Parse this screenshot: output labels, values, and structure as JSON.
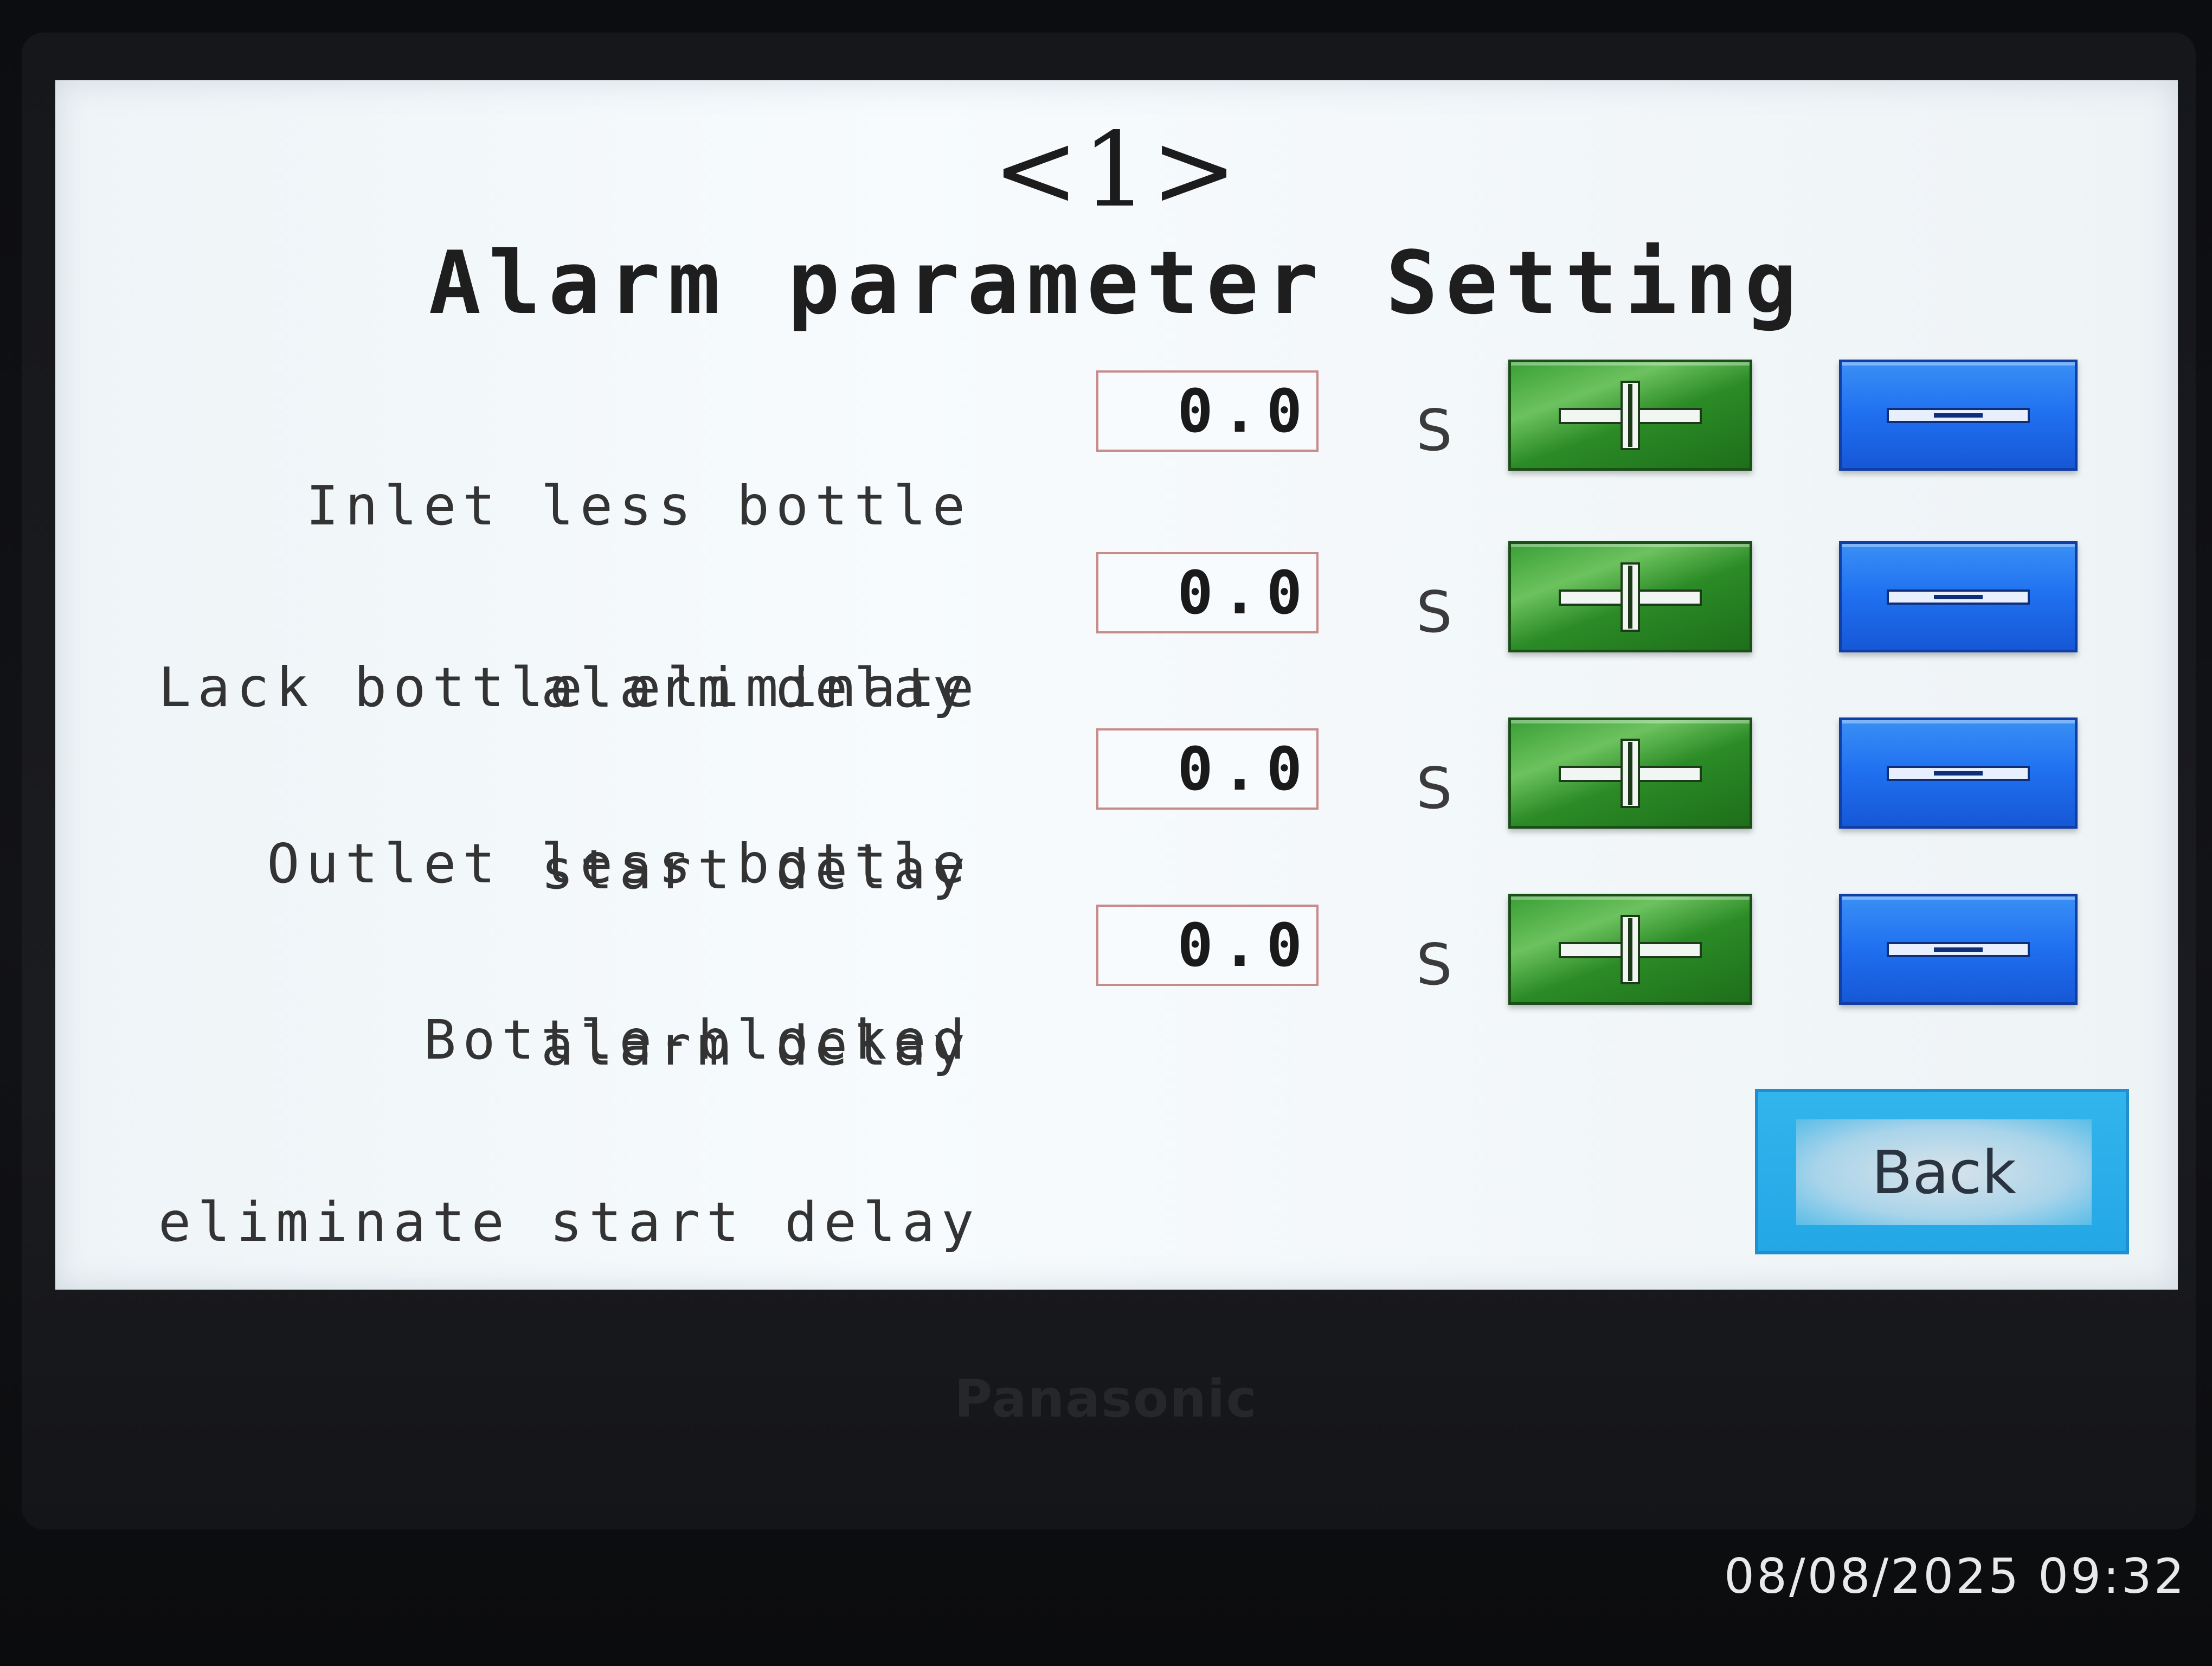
{
  "screen": {
    "page_number": "<1>",
    "title": "Alarm parameter Setting"
  },
  "parameters": [
    {
      "label_line1": "Inlet less bottle",
      "label_line2": "alarm delay",
      "value": "0.0",
      "unit": "S"
    },
    {
      "label_line1": "Lack bottle eliminate",
      "label_line2": "start delay",
      "value": "0.0",
      "unit": "S"
    },
    {
      "label_line1": "Outlet less bottle",
      "label_line2": "alarm delay",
      "value": "0.0",
      "unit": "S"
    },
    {
      "label_line1": "Bottle-blocked",
      "label_line2": "eliminate start delay",
      "value": "0.0",
      "unit": "S"
    }
  ],
  "buttons": {
    "increase_icon": "plus-icon",
    "decrease_icon": "minus-icon",
    "back_label": "Back"
  },
  "device": {
    "brand": "Panasonic"
  },
  "photo": {
    "timestamp": "08/08/2025 09:32"
  },
  "colors": {
    "increase_button": "#2b8b26",
    "decrease_button": "#1f6ff0",
    "back_button": "#24a7e6",
    "value_border": "#c98a8a",
    "screen_bg": "#f2f7fa"
  }
}
